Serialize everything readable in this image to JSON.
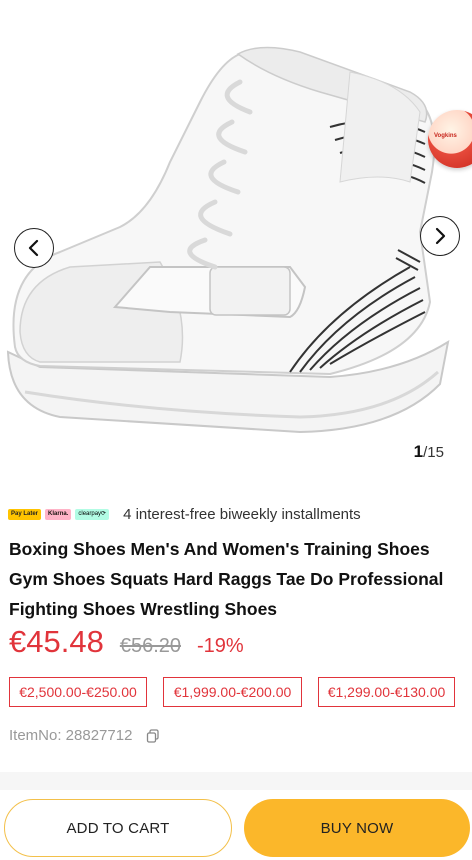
{
  "gallery": {
    "current": "1",
    "total": "/15",
    "badge_text": "Vogkins"
  },
  "payments": {
    "logos": [
      "Pay Later",
      "Klarna.",
      "clearpay⟳"
    ],
    "text": "4 interest-free biweekly installments"
  },
  "product": {
    "title": "Boxing Shoes Men's And Women's Training Shoes Gym Shoes Squats Hard Raggs Tae Do Professional Fighting Shoes Wrestling Shoes",
    "price": "€45.48",
    "old_price": "€56.20",
    "discount": "-19%",
    "tiers": [
      "€2,500.00-€250.00",
      "€1,999.00-€200.00",
      "€1,299.00-€130.00"
    ],
    "item_no": "ItemNo: 28827712"
  },
  "actions": {
    "add_to_cart": "ADD TO CART",
    "buy_now": "BUY NOW"
  },
  "colors": {
    "price_red": "#e1343b",
    "buy_button": "#fbb72a"
  }
}
